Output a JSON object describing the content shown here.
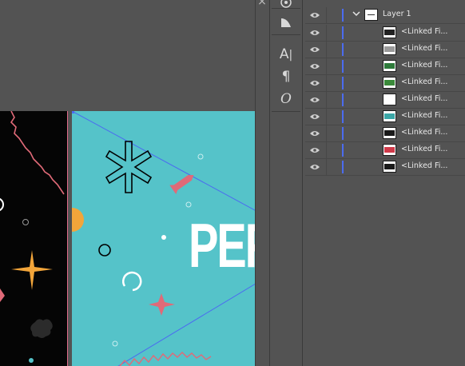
{
  "window": {
    "close_glyph": "×"
  },
  "artboard": {
    "poster_text": "PEF",
    "left_artboard_color": "#050505",
    "main_artboard_color": "#55c3c9",
    "accent_pink": "#e06a78",
    "accent_orange": "#f2a53a",
    "selection_blue": "#4b6cf0"
  },
  "tools": [
    {
      "name": "symbol-sprayer-icon",
      "glyph": "◎"
    },
    {
      "name": "gradient-icon",
      "glyph": "◭"
    },
    {
      "name": "character-icon",
      "glyph": "A|"
    },
    {
      "name": "paragraph-icon",
      "glyph": "¶"
    },
    {
      "name": "opentype-icon",
      "glyph": "O"
    }
  ],
  "layers": {
    "parent": {
      "label": "Layer 1"
    },
    "items": [
      {
        "label": "<Linked Fi...",
        "thumb_color": "#222222"
      },
      {
        "label": "<Linked Fi...",
        "thumb_color": "#9a9a9a"
      },
      {
        "label": "<Linked Fi...",
        "thumb_color": "#2d7a3a"
      },
      {
        "label": "<Linked Fi...",
        "thumb_color": "#3a8a3a"
      },
      {
        "label": "<Linked Fi...",
        "thumb_color": "#ffffff"
      },
      {
        "label": "<Linked Fi...",
        "thumb_color": "#3aa6a6"
      },
      {
        "label": "<Linked Fi...",
        "thumb_color": "#1a1a1a"
      },
      {
        "label": "<Linked Fi...",
        "thumb_color": "#d03a4a"
      },
      {
        "label": "<Linked Fi...",
        "thumb_color": "#1a1a1a"
      }
    ]
  }
}
